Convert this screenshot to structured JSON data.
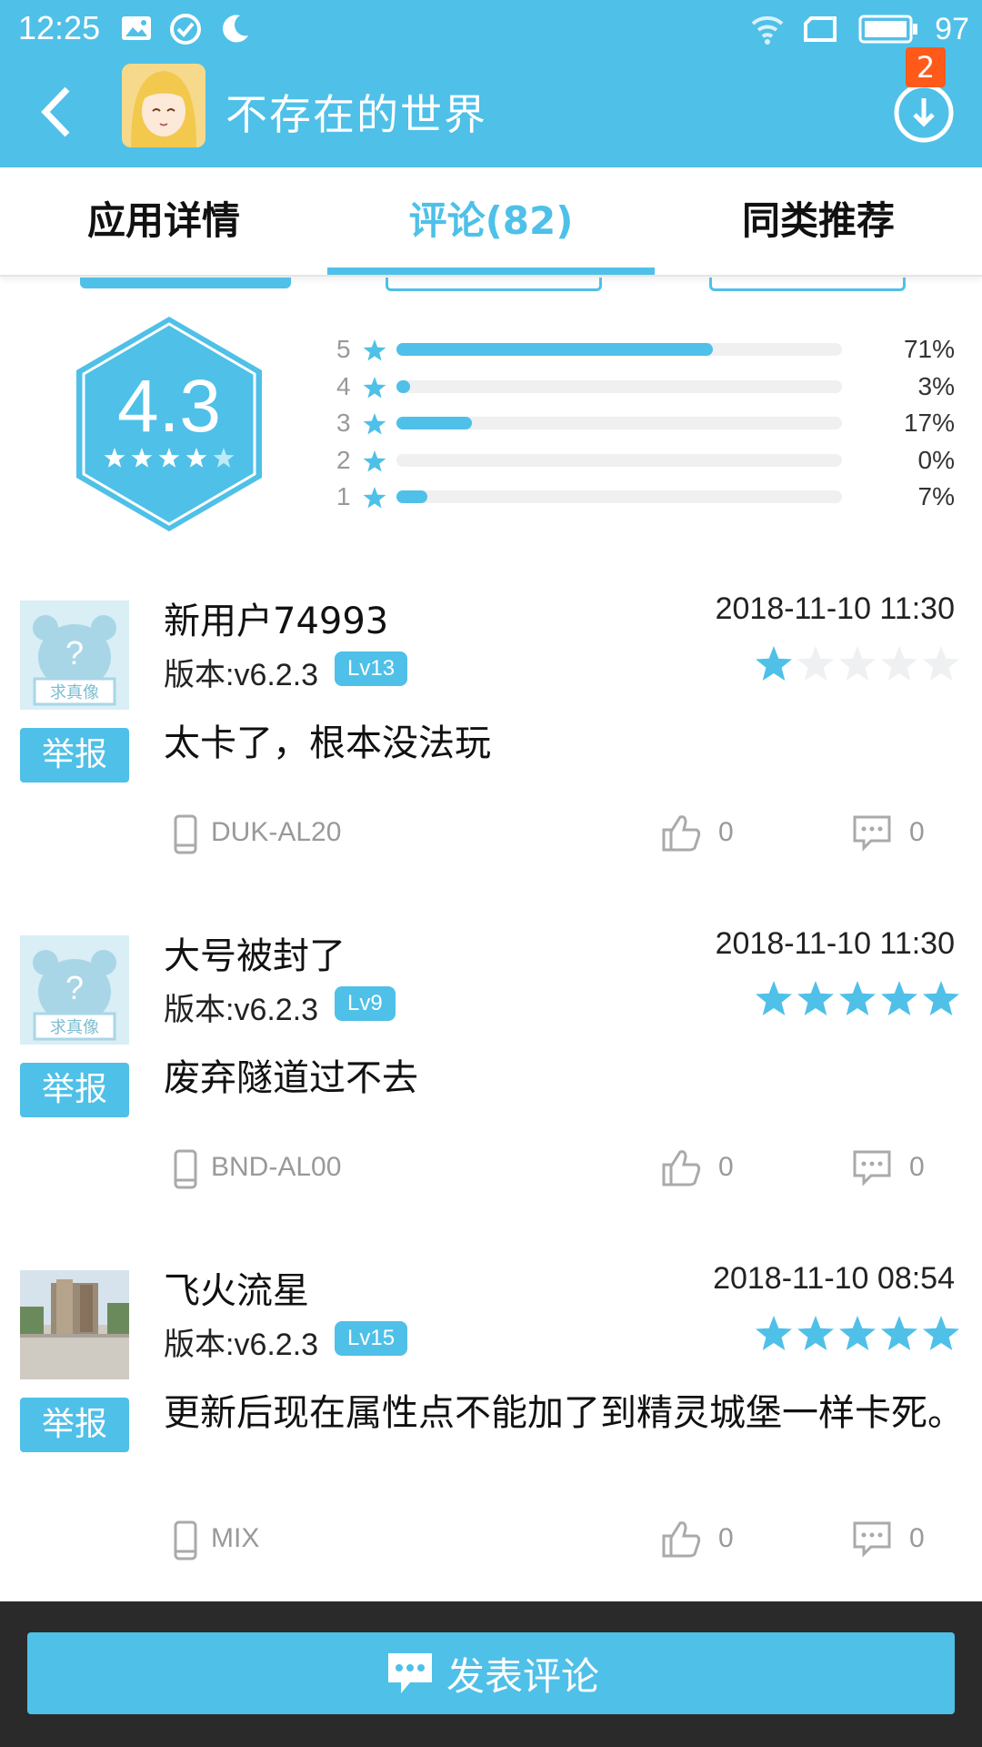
{
  "status_bar": {
    "time": "12:25",
    "battery": "97"
  },
  "header": {
    "title": "不存在的世界",
    "download_badge": "2"
  },
  "tabs": [
    {
      "label": "应用详情",
      "active": false
    },
    {
      "label": "评论(82)",
      "active": true
    },
    {
      "label": "同类推荐",
      "active": false
    }
  ],
  "rating": {
    "score": "4.3",
    "distribution": [
      {
        "stars": "5",
        "percent": "71%",
        "fraction": 0.71
      },
      {
        "stars": "4",
        "percent": "3%",
        "fraction": 0.03
      },
      {
        "stars": "3",
        "percent": "17%",
        "fraction": 0.17
      },
      {
        "stars": "2",
        "percent": "0%",
        "fraction": 0
      },
      {
        "stars": "1",
        "percent": "7%",
        "fraction": 0.07
      }
    ]
  },
  "report_label": "举报",
  "reviews": [
    {
      "name": "新用户74993",
      "date": "2018-11-10 11:30",
      "version": "版本:v6.2.3",
      "level": "Lv13",
      "stars": 1,
      "content": "太卡了，根本没法玩",
      "device": "DUK-AL20",
      "likes": "0",
      "comments": "0",
      "avatar_text": "求真像"
    },
    {
      "name": "大号被封了",
      "date": "2018-11-10 11:30",
      "version": "版本:v6.2.3",
      "level": "Lv9",
      "stars": 5,
      "content": "废弃隧道过不去",
      "device": "BND-AL00",
      "likes": "0",
      "comments": "0",
      "avatar_text": "求真像"
    },
    {
      "name": "飞火流星",
      "date": "2018-11-10 08:54",
      "version": "版本:v6.2.3",
      "level": "Lv15",
      "stars": 5,
      "content": "更新后现在属性点不能加了到精灵城堡一样卡死。",
      "device": "MIX",
      "likes": "0",
      "comments": "0"
    }
  ],
  "bottom": {
    "post_label": "发表评论"
  },
  "colors": {
    "accent": "#4fc0e8",
    "badge": "#ff5a1a",
    "bottom_bar": "#2a2a2a"
  }
}
